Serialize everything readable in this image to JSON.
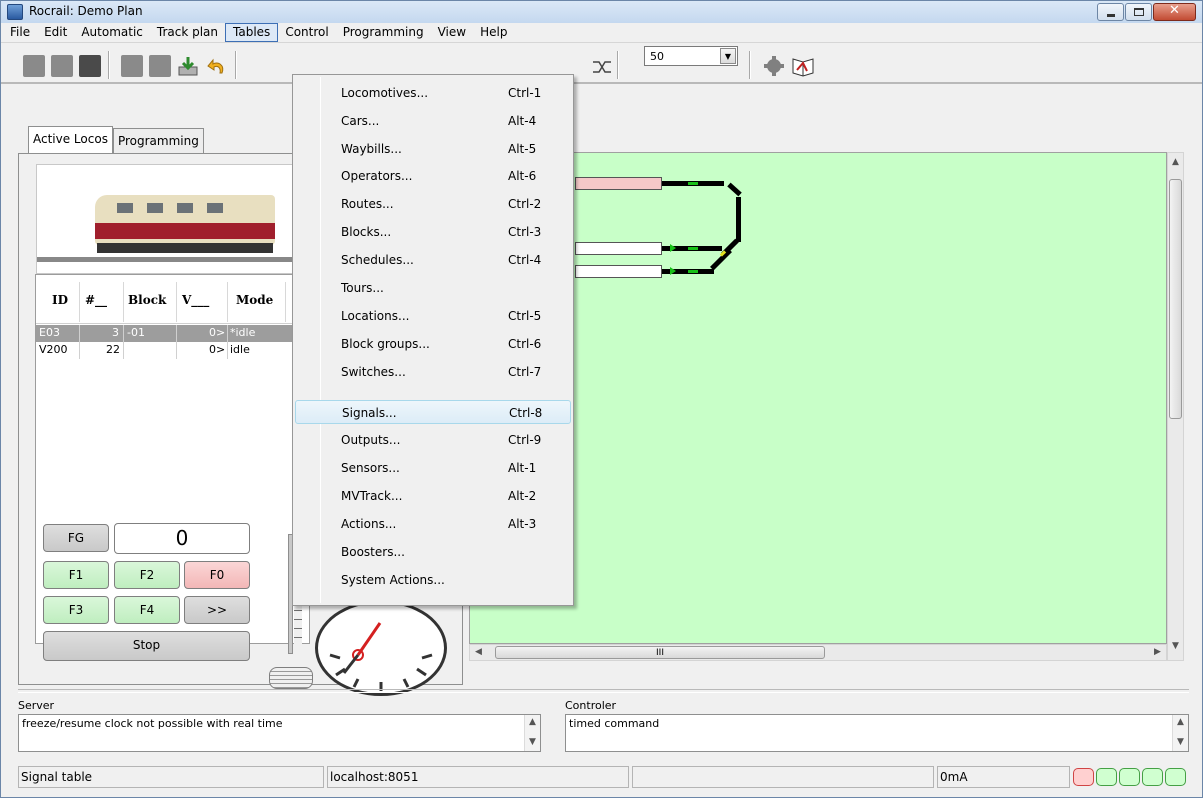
{
  "window": {
    "title": "Rocrail: Demo Plan"
  },
  "menubar": [
    {
      "label": "File"
    },
    {
      "label": "Edit"
    },
    {
      "label": "Automatic"
    },
    {
      "label": "Track plan"
    },
    {
      "label": "Tables"
    },
    {
      "label": "Control"
    },
    {
      "label": "Programming"
    },
    {
      "label": "View"
    },
    {
      "label": "Help"
    }
  ],
  "toolbar": {
    "speed_combo_value": "50"
  },
  "left_panel": {
    "tabs": [
      {
        "label": "Active Locos"
      },
      {
        "label": "Programming"
      }
    ],
    "loco_table": {
      "headers": [
        "ID",
        "#__",
        "Block",
        "V___",
        "Mode"
      ],
      "rows": [
        {
          "id": "E03",
          "num": "3",
          "block": "-01",
          "v": "0>",
          "mode": "*idle"
        },
        {
          "id": "V200",
          "num": "22",
          "block": "",
          "v": "0>",
          "mode": "idle"
        }
      ]
    },
    "controls": {
      "speed_value": "0",
      "fg": "FG",
      "f1": "F1",
      "f2": "F2",
      "f0": "F0",
      "f3": "F3",
      "f4": "F4",
      "more": ">>",
      "stop": "Stop"
    }
  },
  "plan": {
    "hscroll_label": "III"
  },
  "tables_menu": [
    {
      "label": "Locomotives...",
      "shortcut": "Ctrl-1"
    },
    {
      "label": "Cars...",
      "shortcut": "Alt-4"
    },
    {
      "label": "Waybills...",
      "shortcut": "Alt-5"
    },
    {
      "label": "Operators...",
      "shortcut": "Alt-6"
    },
    {
      "label": "Routes...",
      "shortcut": "Ctrl-2"
    },
    {
      "label": "Blocks...",
      "shortcut": "Ctrl-3"
    },
    {
      "label": "Schedules...",
      "shortcut": "Ctrl-4"
    },
    {
      "label": "Tours...",
      "shortcut": ""
    },
    {
      "label": "Locations...",
      "shortcut": "Ctrl-5"
    },
    {
      "label": "Block groups...",
      "shortcut": "Ctrl-6"
    },
    {
      "label": "Switches...",
      "shortcut": "Ctrl-7"
    },
    {
      "label": "Signals...",
      "shortcut": "Ctrl-8"
    },
    {
      "label": "Outputs...",
      "shortcut": "Ctrl-9"
    },
    {
      "label": "Sensors...",
      "shortcut": "Alt-1"
    },
    {
      "label": "MVTrack...",
      "shortcut": "Alt-2"
    },
    {
      "label": "Actions...",
      "shortcut": "Alt-3"
    },
    {
      "label": "Boosters...",
      "shortcut": ""
    },
    {
      "label": "System Actions...",
      "shortcut": ""
    }
  ],
  "logs": {
    "server_label": "Server",
    "server_text": "freeze/resume clock not possible with real time",
    "controller_label": "Controler",
    "controller_text": "timed command"
  },
  "status": {
    "message": "Signal table",
    "host": "localhost:8051",
    "empty": "",
    "current": "0mA"
  },
  "colors": {
    "plan_background": "#c8ffc8",
    "menu_hover": "#dcecf7",
    "selected_row": "#9d9d9d",
    "led_red": "#d04545",
    "led_green": "#45a045"
  }
}
